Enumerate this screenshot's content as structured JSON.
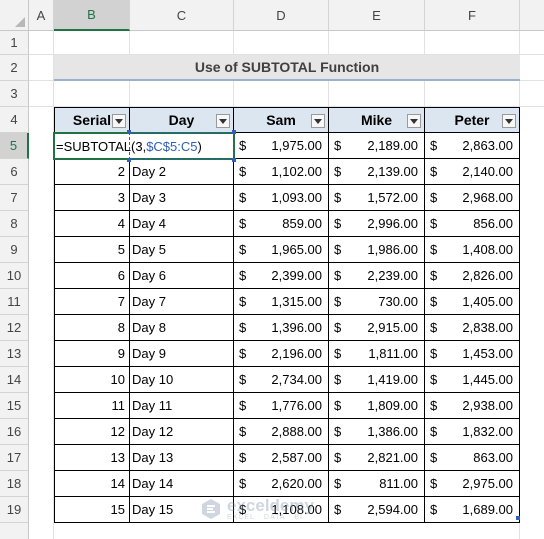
{
  "columns": [
    "A",
    "B",
    "C",
    "D",
    "E",
    "F"
  ],
  "rows": [
    "1",
    "2",
    "3",
    "4",
    "5",
    "6",
    "7",
    "8",
    "9",
    "10",
    "11",
    "12",
    "13",
    "14",
    "15",
    "16",
    "17",
    "18",
    "19"
  ],
  "title": "Use of SUBTOTAL Function",
  "headers": [
    "Serial",
    "Day",
    "Sam",
    "Mike",
    "Peter"
  ],
  "active_cell": {
    "formula_prefix": "=SUBTOTAL(3,",
    "formula_ref": "$C$5:C5",
    "formula_suffix": ")"
  },
  "currency_symbol": "$",
  "data_rows": [
    {
      "serial": "",
      "day": "",
      "sam": "1,975.00",
      "mike": "2,189.00",
      "peter": "2,863.00"
    },
    {
      "serial": "2",
      "day": "Day 2",
      "sam": "1,102.00",
      "mike": "2,139.00",
      "peter": "2,140.00"
    },
    {
      "serial": "3",
      "day": "Day 3",
      "sam": "1,093.00",
      "mike": "1,572.00",
      "peter": "2,968.00"
    },
    {
      "serial": "4",
      "day": "Day 4",
      "sam": "859.00",
      "mike": "2,996.00",
      "peter": "856.00"
    },
    {
      "serial": "5",
      "day": "Day 5",
      "sam": "1,965.00",
      "mike": "1,986.00",
      "peter": "1,408.00"
    },
    {
      "serial": "6",
      "day": "Day 6",
      "sam": "2,399.00",
      "mike": "2,239.00",
      "peter": "2,826.00"
    },
    {
      "serial": "7",
      "day": "Day 7",
      "sam": "1,315.00",
      "mike": "730.00",
      "peter": "1,405.00"
    },
    {
      "serial": "8",
      "day": "Day 8",
      "sam": "1,396.00",
      "mike": "2,915.00",
      "peter": "2,838.00"
    },
    {
      "serial": "9",
      "day": "Day 9",
      "sam": "2,196.00",
      "mike": "1,811.00",
      "peter": "1,453.00"
    },
    {
      "serial": "10",
      "day": "Day 10",
      "sam": "2,734.00",
      "mike": "1,419.00",
      "peter": "1,445.00"
    },
    {
      "serial": "11",
      "day": "Day 11",
      "sam": "1,776.00",
      "mike": "1,809.00",
      "peter": "2,938.00"
    },
    {
      "serial": "12",
      "day": "Day 12",
      "sam": "2,888.00",
      "mike": "1,386.00",
      "peter": "1,832.00"
    },
    {
      "serial": "13",
      "day": "Day 13",
      "sam": "2,587.00",
      "mike": "2,821.00",
      "peter": "863.00"
    },
    {
      "serial": "14",
      "day": "Day 14",
      "sam": "2,620.00",
      "mike": "811.00",
      "peter": "2,975.00"
    },
    {
      "serial": "15",
      "day": "Day 15",
      "sam": "1,108.00",
      "mike": "2,594.00",
      "peter": "1,689.00"
    }
  ],
  "watermark": {
    "brand": "exceldemy",
    "tagline": "EXCEL · DATA · BI"
  },
  "colors": {
    "accent": "#217346",
    "header_fill": "#dce6f1",
    "ref": "#2f5fb8"
  }
}
